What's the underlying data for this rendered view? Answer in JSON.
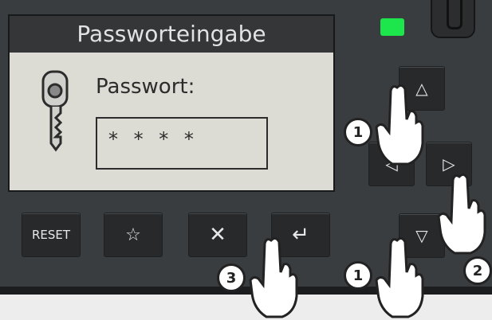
{
  "screen": {
    "title": "Passworteingabe",
    "password_label": "Passwort:",
    "password_value": "* * * *"
  },
  "buttons": {
    "reset": "RESET",
    "star": "☆",
    "cancel": "✕",
    "enter": "↵",
    "up": "△",
    "left": "◁",
    "right": "▷",
    "down": "▽"
  },
  "badges": {
    "step_up": "1",
    "step_down": "1",
    "step_right": "2",
    "step_enter": "3"
  },
  "colors": {
    "led": "#1de64c",
    "panel": "#3a3d40",
    "screen": "#dcdcd4"
  }
}
